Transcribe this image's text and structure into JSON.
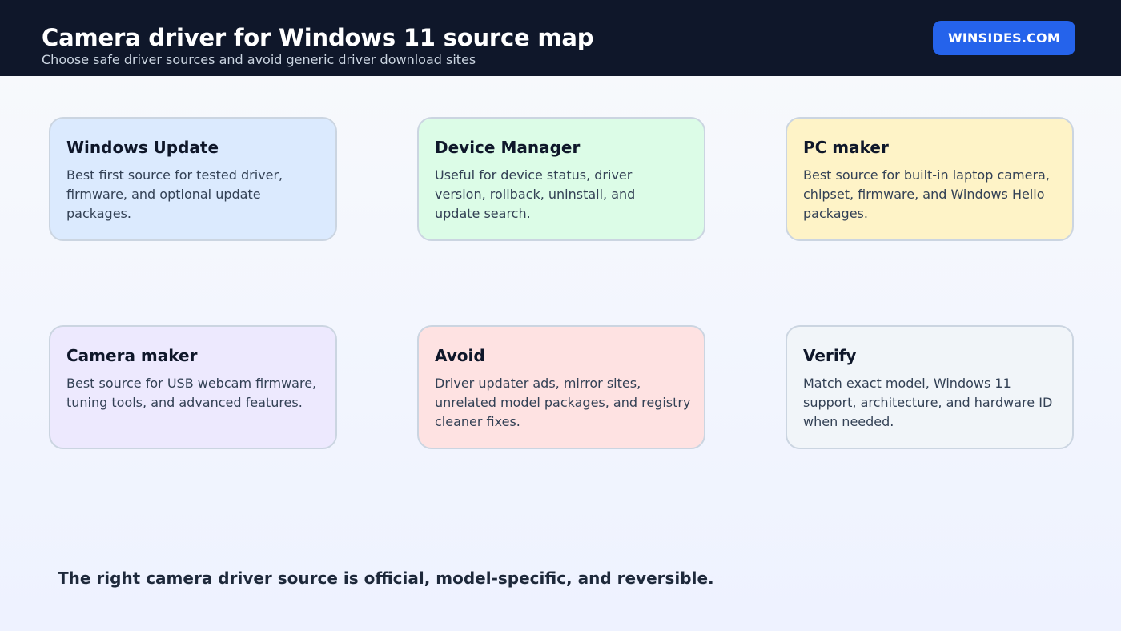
{
  "header": {
    "title": "Camera driver for Windows 11 source map",
    "subtitle": "Choose safe driver sources and avoid generic driver download sites",
    "brand": "WINSIDES.COM"
  },
  "cards": [
    {
      "title": "Windows Update",
      "text": "Best first source for tested driver, firmware, and optional update packages.",
      "color": "#dbeafe"
    },
    {
      "title": "Device Manager",
      "text": "Useful for device status, driver version, rollback, uninstall, and update search.",
      "color": "#dcfce7"
    },
    {
      "title": "PC maker",
      "text": "Best source for built-in laptop camera, chipset, firmware, and Windows Hello packages.",
      "color": "#fef3c7"
    },
    {
      "title": "Camera maker",
      "text": "Best source for USB webcam firmware, tuning tools, and advanced features.",
      "color": "#ede9fe"
    },
    {
      "title": "Avoid",
      "text": "Driver updater ads, mirror sites, unrelated model packages, and registry cleaner fixes.",
      "color": "#fee2e2"
    },
    {
      "title": "Verify",
      "text": "Match exact model, Windows 11 support, architecture, and hardware ID when needed.",
      "color": "#f1f5f9"
    }
  ],
  "footer": {
    "note": "The right camera driver source is official, model-specific, and reversible."
  }
}
